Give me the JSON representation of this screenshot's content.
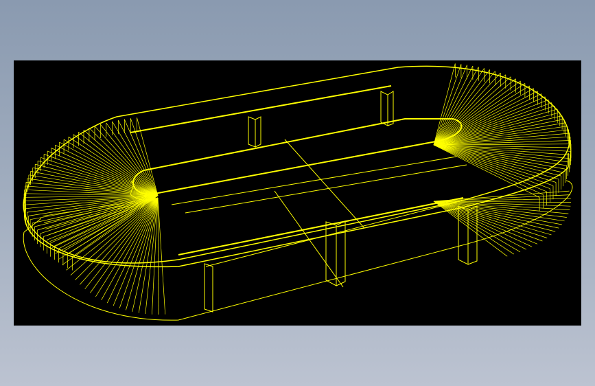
{
  "colors": {
    "background_top": "#8a9ab0",
    "background_bottom": "#bcc3d1",
    "viewport_background": "#000000",
    "wireframe": "#ffff00"
  },
  "viewport": {
    "render_style": "wireframe"
  },
  "model": {
    "shape": "stadium-shaped oval table with central opening and rectangular legs"
  }
}
